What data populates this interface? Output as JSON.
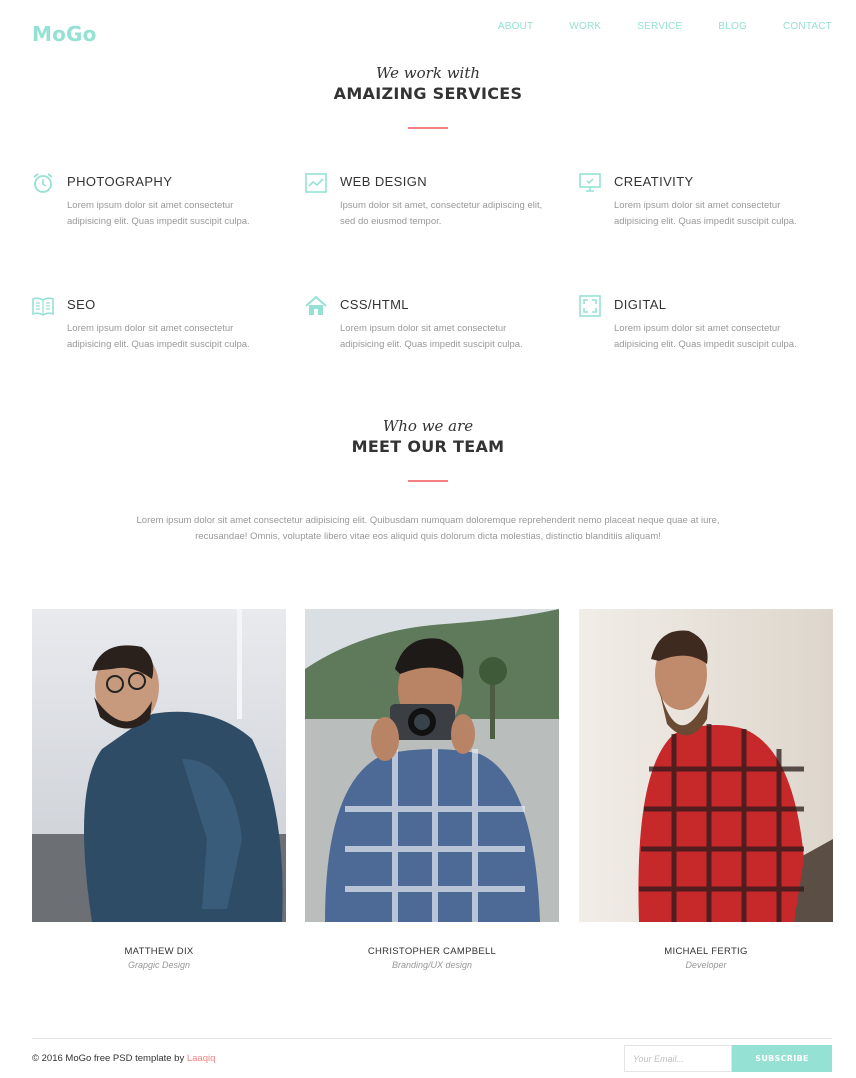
{
  "header": {
    "logo": "MoGo",
    "nav": [
      "ABOUT",
      "WORK",
      "SERVICE",
      "BLOG",
      "CONTACT"
    ]
  },
  "services_section": {
    "script": "We work with",
    "title": "AMAIZING SERVICES",
    "items": [
      {
        "icon": "alarm-clock-icon",
        "title": "PHOTOGRAPHY",
        "text": "Lorem ipsum dolor sit amet consectetur adipisicing elit. Quas impedit suscipit culpa."
      },
      {
        "icon": "chart-line-icon",
        "title": "WEB DESIGN",
        "text": "Ipsum dolor sit amet, consectetur adipiscing elit, sed do eiusmod tempor."
      },
      {
        "icon": "monitor-icon",
        "title": "CREATIVITY",
        "text": "Lorem ipsum dolor sit amet consectetur adipisicing elit. Quas impedit suscipit culpa."
      },
      {
        "icon": "book-icon",
        "title": "SEO",
        "text": "Lorem ipsum dolor sit amet consectetur adipisicing elit. Quas impedit suscipit culpa."
      },
      {
        "icon": "house-icon",
        "title": "CSS/HTML",
        "text": "Lorem ipsum dolor sit amet consectetur adipisicing elit. Quas impedit suscipit culpa."
      },
      {
        "icon": "fullscreen-icon",
        "title": "DIGITAL",
        "text": "Lorem ipsum dolor sit amet consectetur adipisicing elit. Quas impedit suscipit culpa."
      }
    ]
  },
  "team_section": {
    "script": "Who we are",
    "title": "MEET OUR TEAM",
    "intro": "Lorem ipsum dolor sit amet consectetur adipisicing elit. Quibusdam numquam doloremque reprehenderit nemo placeat neque quae at iure, recusandae! Omnis, voluptate libero vitae eos aliquid quis dolorum dicta molestias, distinctio blanditiis aliquam!",
    "members": [
      {
        "name": "MATTHEW DIX",
        "role": "Grapgic Design"
      },
      {
        "name": "CHRISTOPHER CAMPBELL",
        "role": "Branding/UX design"
      },
      {
        "name": "MICHAEL FERTIG",
        "role": "Developer"
      }
    ]
  },
  "footer": {
    "copyright": "© 2016 MoGo free PSD template by ",
    "author": "Laaqiq",
    "email_placeholder": "Your Email...",
    "subscribe": "SUBSCRIBE"
  },
  "colors": {
    "accent": "#95e1d3",
    "highlight": "#f38181",
    "text": "#333333",
    "muted": "#999999"
  }
}
